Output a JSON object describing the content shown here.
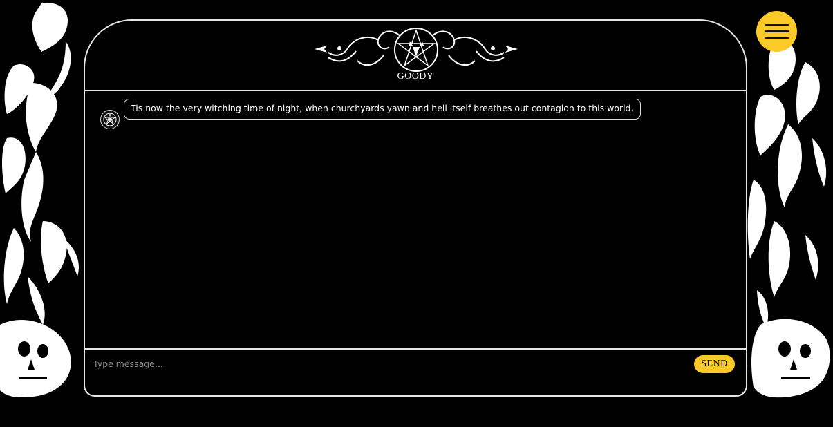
{
  "header": {
    "brand_name": "GOODY"
  },
  "messages": [
    {
      "sender": "bot",
      "avatar_icon": "pentagram-goat-icon",
      "text": "Tis now the very witching time of night, when churchyards yawn and hell itself breathes out contagion to this world."
    }
  ],
  "composer": {
    "placeholder": "Type message...",
    "value": "",
    "send_label": "SEND"
  },
  "menu": {
    "icon": "hamburger-menu-icon"
  },
  "colors": {
    "background": "#000000",
    "accent": "#f9c92a",
    "border": "#e6e6e6",
    "text": "#ffffff"
  }
}
